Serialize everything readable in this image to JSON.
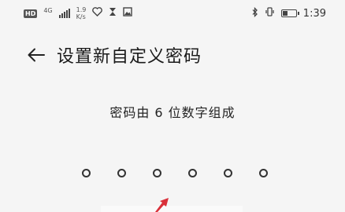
{
  "status_bar": {
    "hd_label": "HD",
    "network_type": "4G",
    "speed_value": "1.9",
    "speed_unit": "K/s",
    "time": "1:39"
  },
  "header": {
    "title": "设置新自定义密码"
  },
  "main": {
    "hint": "密码由 6 位数字组成",
    "pin_length": 6
  }
}
